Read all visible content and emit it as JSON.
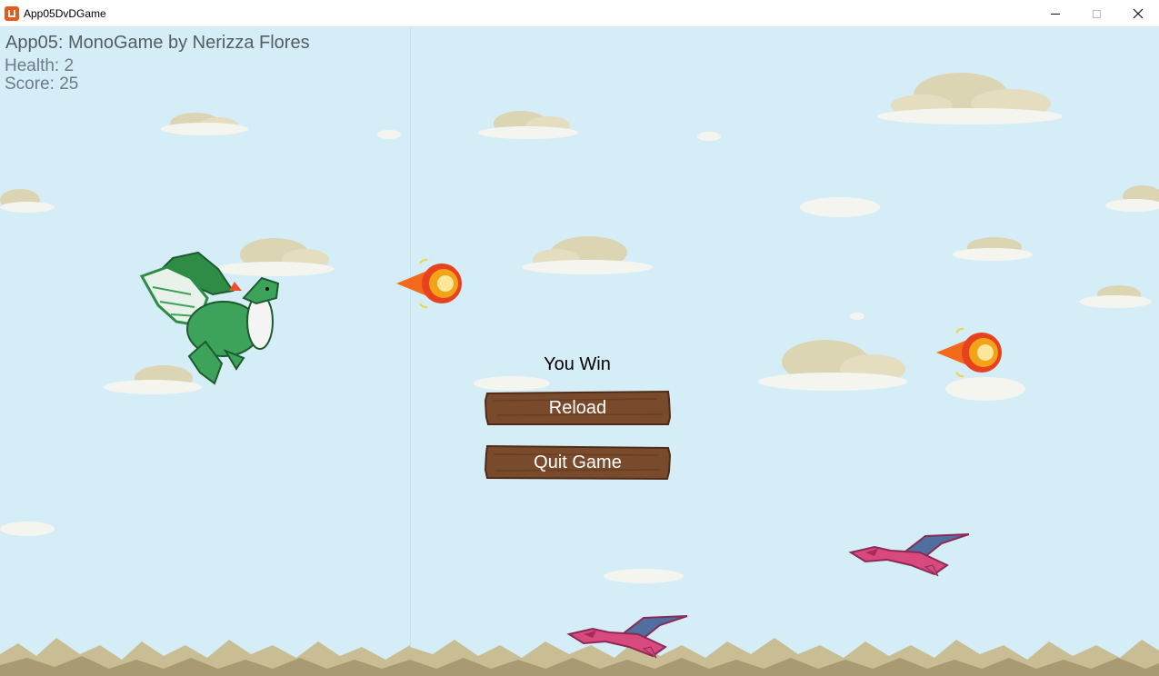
{
  "window": {
    "title": "App05DvDGame",
    "minimize_icon": "minimize-icon",
    "maximize_icon": "maximize-icon",
    "close_icon": "close-icon"
  },
  "hud": {
    "title": "App05: MonoGame by Nerizza Flores",
    "health": "Health: 2",
    "score": "Score: 25"
  },
  "menu": {
    "message": "You Win",
    "reload_label": "Reload",
    "quit_label": "Quit Game"
  },
  "colors": {
    "sky": "#d5edf6",
    "wood": "#7a4a2c",
    "wood_dark": "#4e2c17",
    "player_dragon": "#3ea35a",
    "enemy_dragon": "#d84a7e",
    "fireball": "#f39a1a"
  }
}
